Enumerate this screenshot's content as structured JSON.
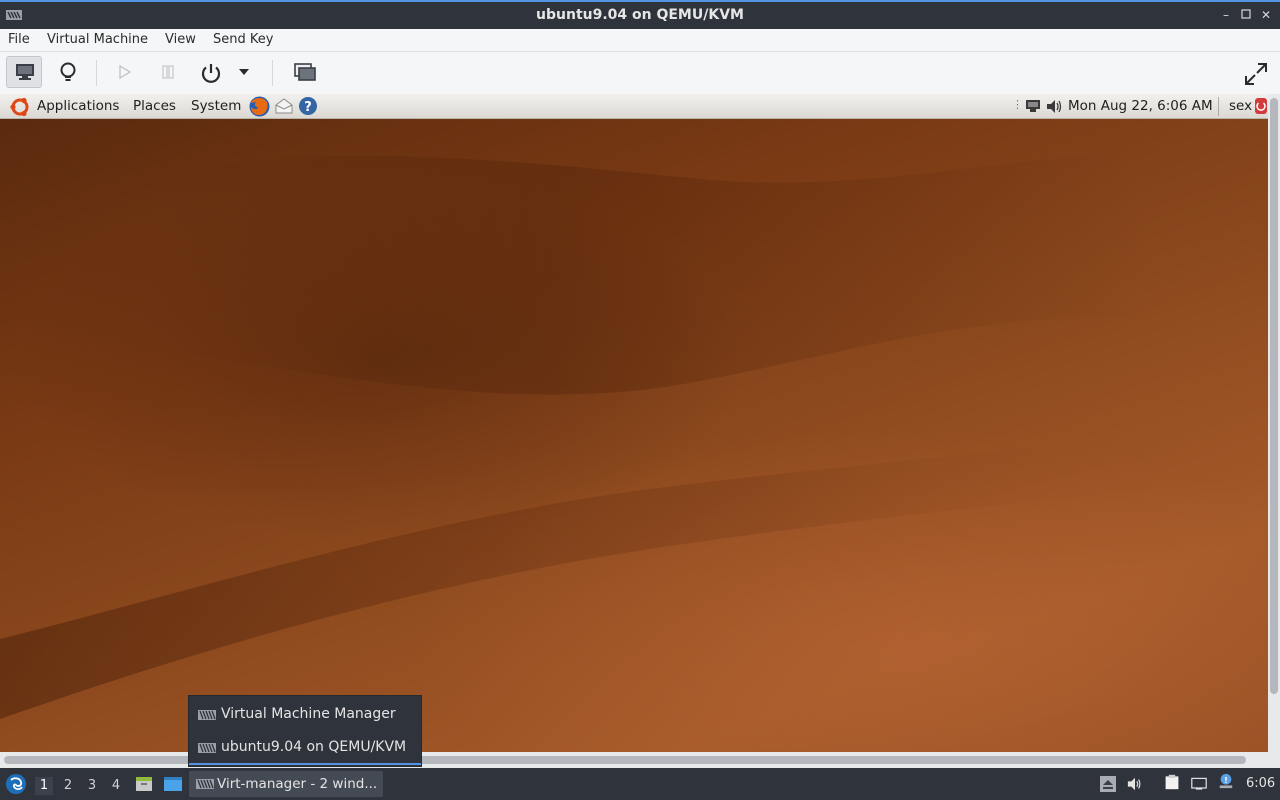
{
  "window": {
    "title": "ubuntu9.04 on QEMU/KVM",
    "controls": [
      "minimize",
      "maximize",
      "close"
    ]
  },
  "menubar": {
    "items": [
      "File",
      "Virtual Machine",
      "View",
      "Send Key"
    ]
  },
  "toolbar": {
    "buttons": [
      "console-icon",
      "lightbulb-icon",
      "run-icon",
      "pause-icon",
      "power-icon",
      "dropdown-arrow-icon",
      "screenshot-icon",
      "fullscreen-icon"
    ]
  },
  "guest_panel": {
    "menus": [
      "Applications",
      "Places",
      "System"
    ],
    "datetime": "Mon Aug 22,  6:06 AM",
    "user": "sex"
  },
  "taskbar": {
    "workspaces": [
      "1",
      "2",
      "3",
      "4"
    ],
    "active_workspace": "1",
    "task_label": "Virt-manager - 2 wind...",
    "clock": "6:06"
  },
  "popup": {
    "items": [
      "Virtual Machine Manager",
      "ubuntu9.04 on QEMU/KVM"
    ],
    "selected_index": 1
  },
  "colors": {
    "accent": "#5294e2",
    "titlebar_bg": "#2f343c",
    "desktop_brown": "#8e4a1e"
  }
}
